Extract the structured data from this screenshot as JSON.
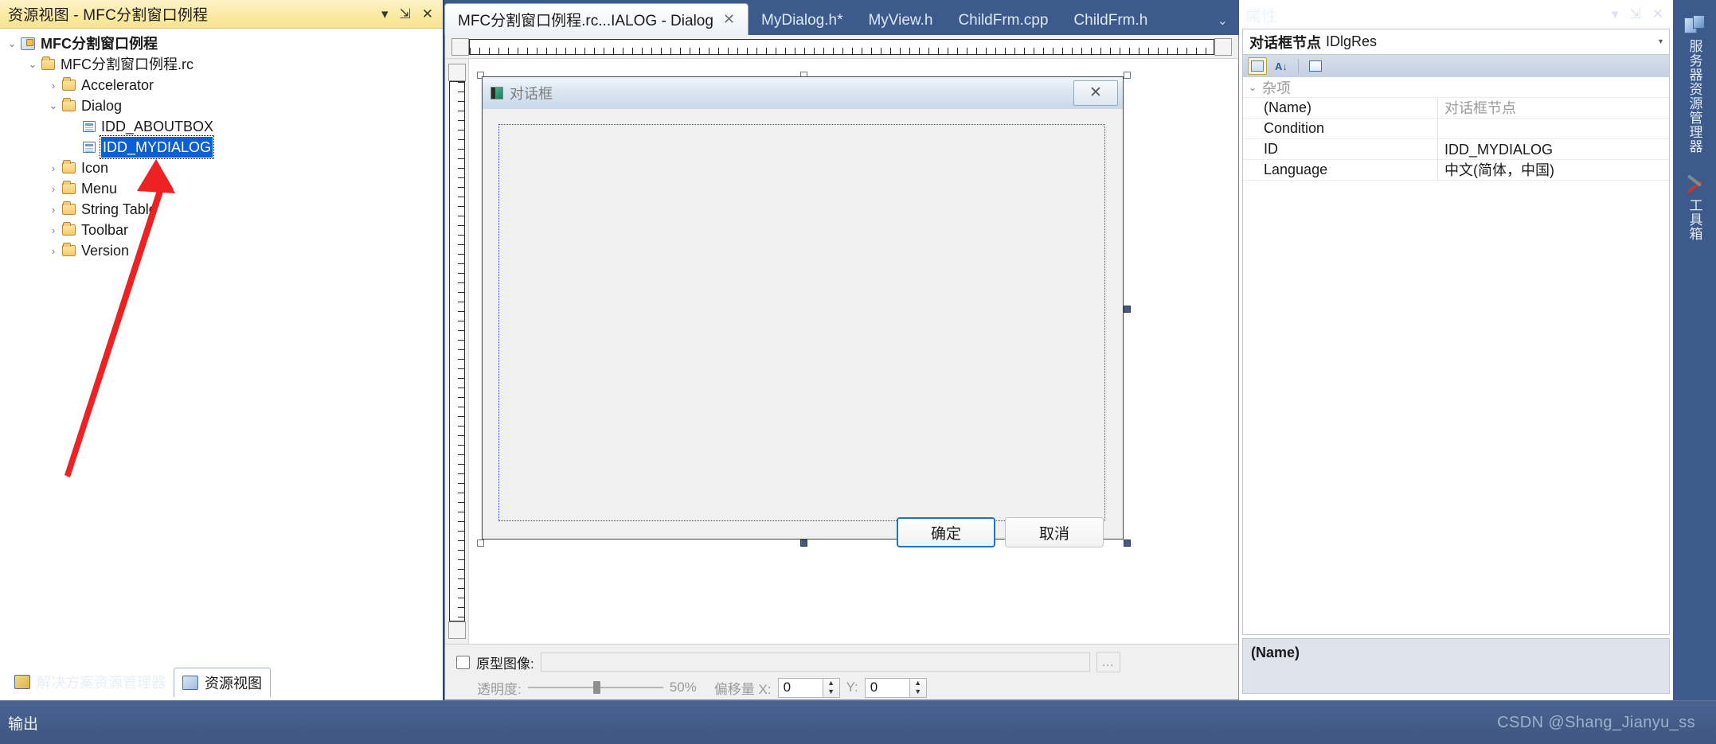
{
  "resource_view": {
    "header_title": "资源视图 - MFC分割窗口例程",
    "header_buttons": [
      {
        "name": "dropdown-icon",
        "glyph": "▾"
      },
      {
        "name": "pin-icon",
        "glyph": "⇲"
      },
      {
        "name": "close-icon",
        "glyph": "✕"
      }
    ],
    "tree": [
      {
        "label": "MFC分割窗口例程",
        "depth": 0,
        "icon": "project-icon",
        "expander": "expanded",
        "bold": true,
        "selected": false
      },
      {
        "label": "MFC分割窗口例程.rc",
        "depth": 1,
        "icon": "folder-icon",
        "expander": "expanded",
        "bold": false,
        "selected": false
      },
      {
        "label": "Accelerator",
        "depth": 2,
        "icon": "folder-icon",
        "expander": "collapsed",
        "bold": false,
        "selected": false
      },
      {
        "label": "Dialog",
        "depth": 2,
        "icon": "folder-icon",
        "expander": "expanded",
        "bold": false,
        "selected": false
      },
      {
        "label": "IDD_ABOUTBOX",
        "depth": 3,
        "icon": "dialog-icon",
        "expander": "none",
        "bold": false,
        "selected": false
      },
      {
        "label": "IDD_MYDIALOG",
        "depth": 3,
        "icon": "dialog-icon",
        "expander": "none",
        "bold": false,
        "selected": true
      },
      {
        "label": "Icon",
        "depth": 2,
        "icon": "folder-icon",
        "expander": "collapsed",
        "bold": false,
        "selected": false
      },
      {
        "label": "Menu",
        "depth": 2,
        "icon": "folder-icon",
        "expander": "collapsed",
        "bold": false,
        "selected": false
      },
      {
        "label": "String Table",
        "depth": 2,
        "icon": "folder-icon",
        "expander": "collapsed",
        "bold": false,
        "selected": false
      },
      {
        "label": "Toolbar",
        "depth": 2,
        "icon": "folder-icon",
        "expander": "collapsed",
        "bold": false,
        "selected": false
      },
      {
        "label": "Version",
        "depth": 2,
        "icon": "folder-icon",
        "expander": "collapsed",
        "bold": false,
        "selected": false
      }
    ],
    "bottom_tabs": [
      {
        "label": "解决方案资源管理器",
        "active": false
      },
      {
        "label": "资源视图",
        "active": true
      }
    ]
  },
  "document_tabs": {
    "tabs": [
      {
        "label": "MFC分割窗口例程.rc...IALOG - Dialog",
        "active": true,
        "closable": true
      },
      {
        "label": "MyDialog.h*",
        "active": false,
        "closable": false
      },
      {
        "label": "MyView.h",
        "active": false,
        "closable": false
      },
      {
        "label": "ChildFrm.cpp",
        "active": false,
        "closable": false
      },
      {
        "label": "ChildFrm.h",
        "active": false,
        "closable": false
      }
    ],
    "overflow_glyph": "⌄"
  },
  "dialog_editor": {
    "dialog_title": "对话框",
    "close_glyph": "✕",
    "buttons": [
      {
        "label": "确定",
        "default": true
      },
      {
        "label": "取消",
        "default": false
      }
    ],
    "prototype_bar": {
      "checkbox_label": "原型图像:",
      "path_value": "",
      "browse_label": "...",
      "opacity_label": "透明度:",
      "opacity_value": "50%",
      "offset_label": "偏移量 X:",
      "offset_x": "0",
      "offset_y_label": "Y:",
      "offset_y": "0"
    }
  },
  "properties": {
    "title": "属性",
    "header_buttons": [
      {
        "name": "dropdown-icon",
        "glyph": "▾"
      },
      {
        "name": "pin-icon",
        "glyph": "⇲"
      },
      {
        "name": "close-icon",
        "glyph": "✕"
      }
    ],
    "object_name": "对话框节点",
    "object_type": "IDlgRes",
    "object_caret": "▾",
    "toolbar": [
      {
        "name": "categorized-button",
        "active": true
      },
      {
        "name": "alphabetical-button",
        "active": false
      },
      {
        "name": "property-pages-button",
        "active": false
      }
    ],
    "rows": [
      {
        "category": true,
        "name": "杂项",
        "value": "",
        "greyed": true
      },
      {
        "category": false,
        "name": "(Name)",
        "value": "对话框节点",
        "greyed": true
      },
      {
        "category": false,
        "name": "Condition",
        "value": "",
        "greyed": false
      },
      {
        "category": false,
        "name": "ID",
        "value": "IDD_MYDIALOG",
        "greyed": false
      },
      {
        "category": false,
        "name": "Language",
        "value": "中文(简体，中国)",
        "greyed": false
      }
    ],
    "description_title": "(Name)"
  },
  "vertical_tabs": [
    {
      "label": "服务器资源管理器",
      "icon": "server-explorer-icon"
    },
    {
      "label": "工具箱",
      "icon": "toolbox-icon"
    }
  ],
  "status_bar": {
    "output_label": "输出",
    "watermark": "CSDN @Shang_Jianyu_ss"
  },
  "colors": {
    "chrome": "#31456a",
    "accent_yellow": "#f8e393",
    "selection_blue": "#0a5fd4",
    "annotation_red": "#ee2222"
  }
}
